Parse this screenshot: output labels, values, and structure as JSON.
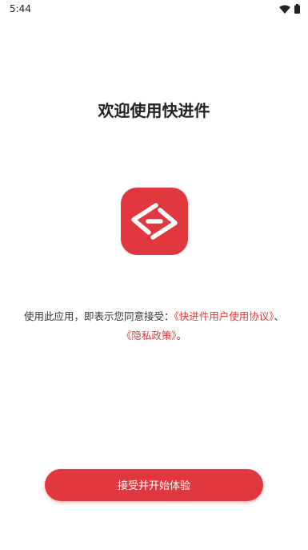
{
  "status_bar": {
    "time": "5:44",
    "icons": [
      "wifi-icon",
      "battery-icon"
    ]
  },
  "welcome": {
    "title": "欢迎使用快进件"
  },
  "logo": {
    "icon": "app-logo-icon",
    "color": "#e0383e"
  },
  "agreement": {
    "prefix": "使用此应用，即表示您同意接受：",
    "user_agreement_link": "《快进件用户使用协议》",
    "separator": "、",
    "privacy_policy_link": "《隐私政策》",
    "suffix": "。"
  },
  "accept_button": {
    "label": "接受并开始体验"
  },
  "colors": {
    "accent": "#e0383e",
    "text": "#333333",
    "background": "#ffffff"
  }
}
